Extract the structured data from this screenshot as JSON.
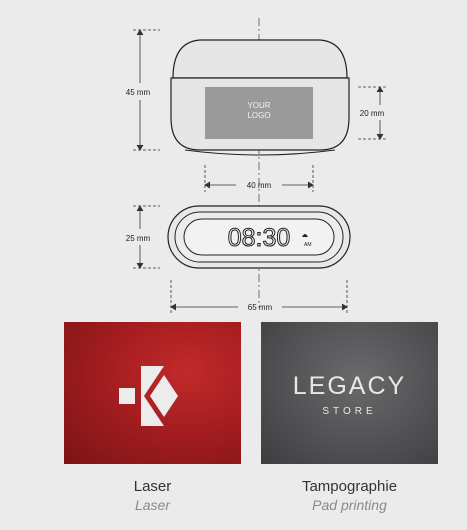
{
  "dimensions": {
    "height_top": "45 mm",
    "logo_height": "20 mm",
    "logo_width": "40 mm",
    "height_front": "25 mm",
    "width_front": "65 mm"
  },
  "logo_placeholder": {
    "line1": "YOUR",
    "line2": "LOGO"
  },
  "clock": {
    "time": "08:30",
    "indicator": "AM"
  },
  "pad_sample": {
    "brand": "LEGACY",
    "sub": "STORE"
  },
  "options": [
    {
      "label": "Laser",
      "translation": "Laser"
    },
    {
      "label": "Tampographie",
      "translation": "Pad printing"
    }
  ],
  "colors": {
    "laser_red": "#a51d20",
    "pad_gray": "#565658"
  }
}
